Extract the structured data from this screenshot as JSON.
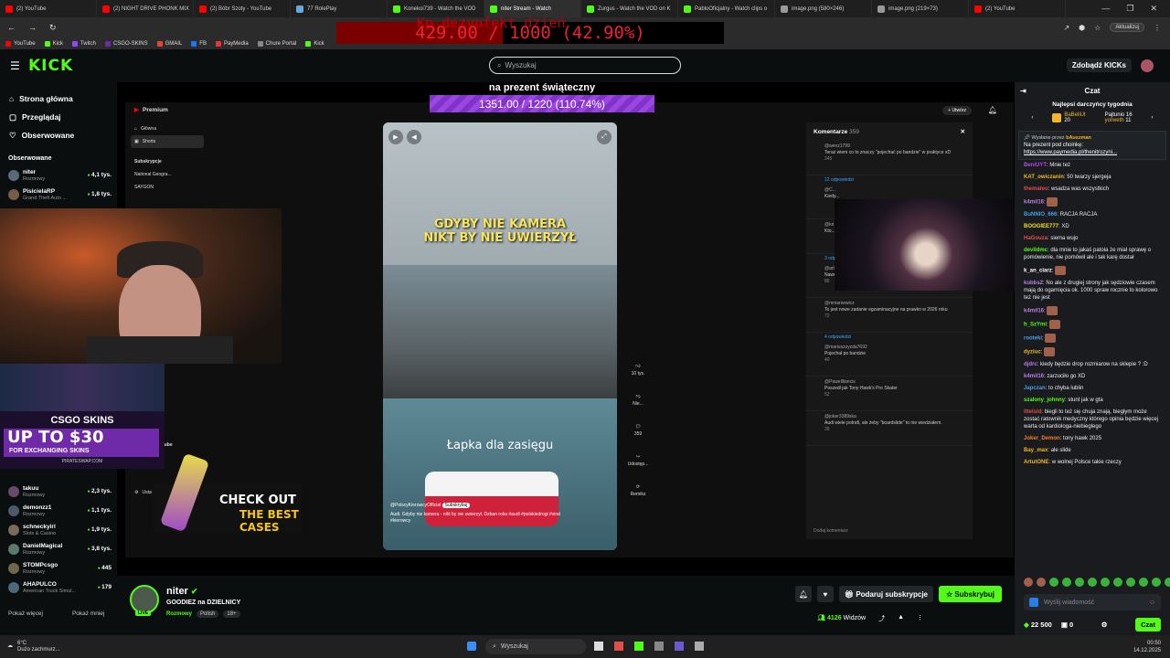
{
  "browser": {
    "tabs": [
      {
        "label": "(2) YouTube",
        "color": "#ff0000",
        "active": false
      },
      {
        "label": "(2) NIGHT DRIVE PHONK MIX",
        "color": "#ff0000",
        "active": false
      },
      {
        "label": "(2) Bóbr Szoty - YouTube",
        "color": "#ff0000",
        "active": false
      },
      {
        "label": "77 RolePlay",
        "color": "#6ad",
        "active": false
      },
      {
        "label": "Konekoi739 - Watch the VOD",
        "color": "#53fc18",
        "active": false
      },
      {
        "label": "niter Stream - Watch",
        "color": "#53fc18",
        "active": true
      },
      {
        "label": "Zurgus - Watch the VOD on K",
        "color": "#53fc18",
        "active": false
      },
      {
        "label": "PabloOficjalny - Watch clips o",
        "color": "#53fc18",
        "active": false
      },
      {
        "label": "image.png (580×246)",
        "color": "#999",
        "active": false
      },
      {
        "label": "image.png (219×73)",
        "color": "#999",
        "active": false
      },
      {
        "label": "(2) YouTube",
        "color": "#ff0000",
        "active": false
      }
    ],
    "update_label": "Aktualizuj",
    "bookmarks": [
      "YouTube",
      "Kick",
      "Twitch",
      "CSGO-SKINS",
      "GMAIL",
      "FB",
      "PayMedia",
      "Chure Portal",
      "Kick"
    ]
  },
  "overlay_goal": {
    "ghost_text": "Kp dezynfekt dzień",
    "current": "429.00",
    "target": "1000",
    "percent_text": "(42.90%)",
    "percent": 42.9
  },
  "gift_goal": {
    "title": "na prezent świąteczny",
    "progress": "1351.00 / 1220 (110.74%)"
  },
  "header": {
    "logo": "KICK",
    "search_placeholder": "Wyszukaj",
    "kicks_label": "Zdobądź KICKs"
  },
  "sidebar": {
    "nav": [
      {
        "label": "Strona główna",
        "icon": "home-icon"
      },
      {
        "label": "Przeglądaj",
        "icon": "browse-icon"
      },
      {
        "label": "Obserwowane",
        "icon": "heart-icon"
      }
    ],
    "followed_title": "Obserwowane",
    "channels": [
      {
        "name": "niter",
        "category": "Rozmowy",
        "viewers": "4,1 tys."
      },
      {
        "name": "PisicielaRP",
        "category": "Grand Theft Auto ...",
        "viewers": "1,8 tys."
      },
      {
        "name": "takuu",
        "category": "Rozmowy",
        "viewers": "2,3 tys."
      },
      {
        "name": "demonzz1",
        "category": "Rozmowy",
        "viewers": "1,1 tys."
      },
      {
        "name": "schneckyirl",
        "category": "Slots & Casino",
        "viewers": "1,9 tys."
      },
      {
        "name": "DanielMagical",
        "category": "Rozmowy",
        "viewers": "3,8 tys."
      },
      {
        "name": "STOMPcsgo",
        "category": "Rozmowy",
        "viewers": "445"
      },
      {
        "name": "AHAPULCO",
        "category": "American Truck Simul...",
        "viewers": "179"
      }
    ],
    "show_more": "Pokaż więcej",
    "show_less": "Pokaż mniej"
  },
  "youtube": {
    "premium_label": "Premium",
    "nav": [
      "Główna",
      "Shorts"
    ],
    "subs_title": "Subskrypcje",
    "subs": [
      "National Geogra...",
      "SAYGON"
    ],
    "more_title": "Więcej z YouTube",
    "settings": "Ustawienia",
    "create_label": "Utwórz",
    "short_top_text": "GDYBY NIE KAMERA NIKT BY NIE UWIERZYŁ",
    "short_bottom_text": "Łapka dla zasięgu",
    "channel_handle": "@PolscyKierowcyOfficial",
    "subscribe_small": "Subskrybuj",
    "caption": "Audi. Gdyby nie kamera - nikt by nie uwierzył. Dzban roku #audi #polskiedrogi #viral #kierowcy",
    "likes": "10 tys.",
    "dislike": "Nie...",
    "comments_count": "359",
    "share": "Udostęp...",
    "remix": "Remiks",
    "comments_title": "Komentarze",
    "comments_total": "359",
    "comments": [
      {
        "user": "@wenz1799",
        "text": "Teraz wiem co to znaczy \"pojechać po bandzie\" w praktyce xD",
        "likes": "245"
      },
      {
        "user": "@C...",
        "text": "Kiedy...",
        "likes": ""
      },
      {
        "user": "@kri...",
        "text": "Kto...",
        "likes": ""
      },
      {
        "user": "@arlato5791",
        "text": "Nawet AI by tego nie wymyślił",
        "likes": "85"
      },
      {
        "user": "@mmaniewicz",
        "text": "To jest nowe zadanie egzaminacyjne na prawko w 2026 roku",
        "likes": "72"
      },
      {
        "user": "@mariuszzyzda7692",
        "text": "Pojechał po bandzie",
        "likes": "40"
      },
      {
        "user": "@Pawellliancis",
        "text": "Poszedł jak Tony Hawk's Pro Skater",
        "likes": "52"
      },
      {
        "user": "@joker3389ska",
        "text": "Audi wiele potrafi, ale żeby \"boardslide\" to nie wiedziałem.",
        "likes": "39"
      }
    ],
    "replies_12": "12 odpowiedzi",
    "replies_3": "3 odpowiedzi",
    "replies_4": "4 odpowiedzi",
    "add_comment": "Dodaj komentarz"
  },
  "ads": {
    "brand": "CSGO SKINS",
    "up_to": "UP TO $30",
    "for": "FOR EXCHANGING SKINS",
    "site": "PIRATESWAP.COM",
    "check_line1": "CHECK OUT",
    "check_line2": "THE BEST CASES"
  },
  "stream_info": {
    "name": "niter",
    "title": "GOODIEZ na DZIELNICY",
    "category": "Rozmowy",
    "tags": [
      "Polish",
      "18+"
    ],
    "live": "LIVE",
    "gift_sub": "Podaruj subskrypcje",
    "subscribe": "Subskrybuj",
    "viewers": "4126",
    "viewers_label": "Widzów"
  },
  "chat": {
    "title": "Czat",
    "top_title": "Najlepsi darczyńcy tygodnia",
    "top_gifters": [
      {
        "name": "BaBeliUt",
        "count": "20"
      },
      {
        "name": "Pajtunio",
        "count": "16"
      },
      {
        "name": "yorweth",
        "count": "11"
      }
    ],
    "pinned_by_label": "Wysłane przez",
    "pinned_by": "bAuszman",
    "pinned_text": "Na prezent pod choinkę:",
    "pinned_link": "https://www.paymedia.pl/thenitrozyni...",
    "messages": [
      {
        "user": "BeniUYT",
        "color": "#b04ae0",
        "text": "Mnie też"
      },
      {
        "user": "KAT_owiczanin",
        "color": "#f2b728",
        "text": "50 twarzy sjergeja"
      },
      {
        "user": "themateo",
        "color": "#e0504a",
        "text": "wsadza was wszystkich"
      },
      {
        "user": "k4mil16",
        "color": "#c07de9",
        "text": ""
      },
      {
        "user": "BuNNIO_666",
        "color": "#4a9de9",
        "text": "RACJA RACJA"
      },
      {
        "user": "BOOGIEE777",
        "color": "#f2e028",
        "text": "XD"
      },
      {
        "user": "HaGouza",
        "color": "#e0504a",
        "text": "siema wujo"
      },
      {
        "user": "devildmc",
        "color": "#53fc18",
        "text": "dla mnie to jakaś patola że miał sprawę o pomówienie, nie pomówił ale i tak karę dostał"
      },
      {
        "user": "k_an_ciarz",
        "color": "#fff",
        "text": ""
      },
      {
        "user": "kubbs2",
        "color": "#c07de9",
        "text": "No ale z drugiej strony jak sędziowie czasem mają do ogarnięcia ok. 1000 spraw rocznie to kolorowo też nie jest"
      },
      {
        "user": "k4mil16",
        "color": "#c07de9",
        "text": ""
      },
      {
        "user": "h_SzYmi",
        "color": "#53fc18",
        "text": ""
      },
      {
        "user": "rooteki",
        "color": "#4a9de9",
        "text": ""
      },
      {
        "user": "dyziuc",
        "color": "#f2b728",
        "text": ""
      },
      {
        "user": "djdrc",
        "color": "#c07de9",
        "text": "kiedy będzie drop rozmiarow na sklepie ? :D"
      },
      {
        "user": "k4mil16",
        "color": "#c07de9",
        "text": "zarzuciło go XD"
      },
      {
        "user": "Japczan",
        "color": "#4a9de9",
        "text": "to chyba lublin"
      },
      {
        "user": "szalony_johnny",
        "color": "#53fc18",
        "text": "stunt jak w gta"
      },
      {
        "user": "ittelsld",
        "color": "#e0504a",
        "text": "biegli to też się chuja znają, biegłym może zostać ratownik medyczny którego opinia będzie więcej warta od kardiologa-niebieglego"
      },
      {
        "user": "Joker_Demon",
        "color": "#f27f28",
        "text": "tony hawk 2025"
      },
      {
        "user": "Bay_max",
        "color": "#f2b728",
        "text": "ale slide"
      },
      {
        "user": "ArtutONE",
        "color": "#f2b728",
        "text": "w wolnej Polsce takie rzeczy"
      }
    ],
    "input_placeholder": "Wyślij wiadomość",
    "kicks_balance": "22 500",
    "points": "0",
    "send_label": "Czat"
  },
  "taskbar": {
    "temp": "6°C",
    "weather": "Dużo zachmurz...",
    "search": "Wyszukaj",
    "time": "00:50",
    "date": "14.12.2025"
  }
}
